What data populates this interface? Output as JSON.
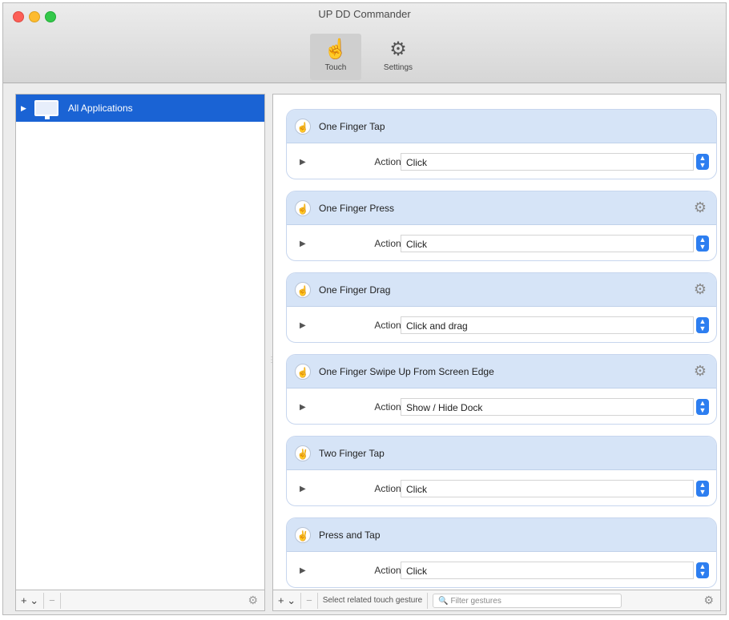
{
  "window": {
    "title": "UP DD Commander"
  },
  "toolbar": {
    "items": [
      {
        "label": "Touch",
        "icon": "hand-pointer-icon"
      },
      {
        "label": "Settings",
        "icon": "gear-icon"
      }
    ]
  },
  "sidebar": {
    "item": {
      "label": "All Applications",
      "icon": "monitor-icon"
    }
  },
  "left_controls": {
    "add": "+ ⌄",
    "remove": "−",
    "action_icon": "gear-icon"
  },
  "right_controls": {
    "add": "+ ⌄",
    "remove": "−",
    "select_label": "Select related touch gesture",
    "filter_placeholder": "Filter gestures",
    "action_icon": "gear-icon"
  },
  "action_label": "Action:",
  "gestures": [
    {
      "name": "One Finger Tap",
      "action": "Click",
      "gear": false
    },
    {
      "name": "One Finger Press",
      "action": "Click",
      "gear": true
    },
    {
      "name": "One Finger Drag",
      "action": "Click and drag",
      "gear": true
    },
    {
      "name": "One Finger Swipe Up From Screen Edge",
      "action": "Show / Hide Dock",
      "gear": true
    },
    {
      "name": "Two Finger Tap",
      "action": "Click",
      "gear": false
    },
    {
      "name": "Press and Tap",
      "action": "Click",
      "gear": false
    }
  ],
  "colors": {
    "selection": "#1a63d4",
    "card_header": "#d6e4f7",
    "stepper": "#2d7ef0"
  }
}
